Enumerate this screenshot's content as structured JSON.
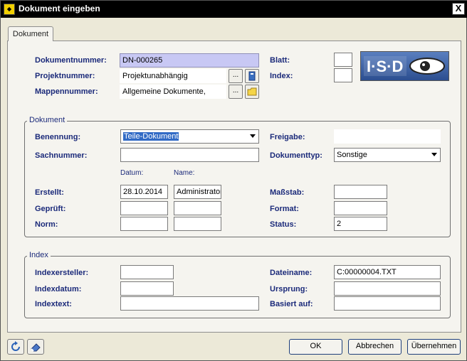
{
  "window": {
    "title": "Dokument eingeben",
    "close_glyph": "X"
  },
  "tab": {
    "label": "Dokument"
  },
  "header": {
    "dokumentnummer_label": "Dokumentnummer:",
    "dokumentnummer_value": "DN-000265",
    "projektnummer_label": "Projektnummer:",
    "projektnummer_value": "Projektunabhängig",
    "mappennummer_label": "Mappennummer:",
    "mappennummer_value": "Allgemeine Dokumente,",
    "browse_glyph": "...",
    "blatt_label": "Blatt:",
    "blatt_value": "",
    "index_label": "Index:",
    "index_value": "",
    "logo_text": "I·S·D"
  },
  "dokument_group": {
    "title": "Dokument",
    "benennung_label": "Benennung:",
    "benennung_value": "Teile-Dokument",
    "sachnummer_label": "Sachnummer:",
    "sachnummer_value": "",
    "freigabe_label": "Freigabe:",
    "freigabe_value": "",
    "dokumenttyp_label": "Dokumenttyp:",
    "dokumenttyp_value": "Sonstige",
    "datum_header": "Datum:",
    "name_header": "Name:",
    "erstellt_label": "Erstellt:",
    "erstellt_datum": "28.10.2014",
    "erstellt_name": "Administrator",
    "geprueft_label": "Geprüft:",
    "geprueft_datum": "",
    "geprueft_name": "",
    "norm_label": "Norm:",
    "norm_datum": "",
    "norm_name": "",
    "massstab_label": "Maßstab:",
    "massstab_value": "",
    "format_label": "Format:",
    "format_value": "",
    "status_label": "Status:",
    "status_value": "2"
  },
  "index_group": {
    "title": "Index",
    "indexersteller_label": "Indexersteller:",
    "indexersteller_value": "",
    "indexdatum_label": "Indexdatum:",
    "indexdatum_value": "",
    "indextext_label": "Indextext:",
    "indextext_value": "",
    "dateiname_label": "Dateiname:",
    "dateiname_value": "C:00000004.TXT",
    "ursprung_label": "Ursprung:",
    "ursprung_value": "",
    "basiert_label": "Basiert auf:",
    "basiert_value": ""
  },
  "footer": {
    "ok_label": "OK",
    "abbrechen_label": "Abbrechen",
    "uebernehmen_label": "Übernehmen"
  },
  "colors": {
    "label": "#1b2a7a",
    "highlight_field": "#c8c8f4",
    "selection": "#316ac5"
  }
}
